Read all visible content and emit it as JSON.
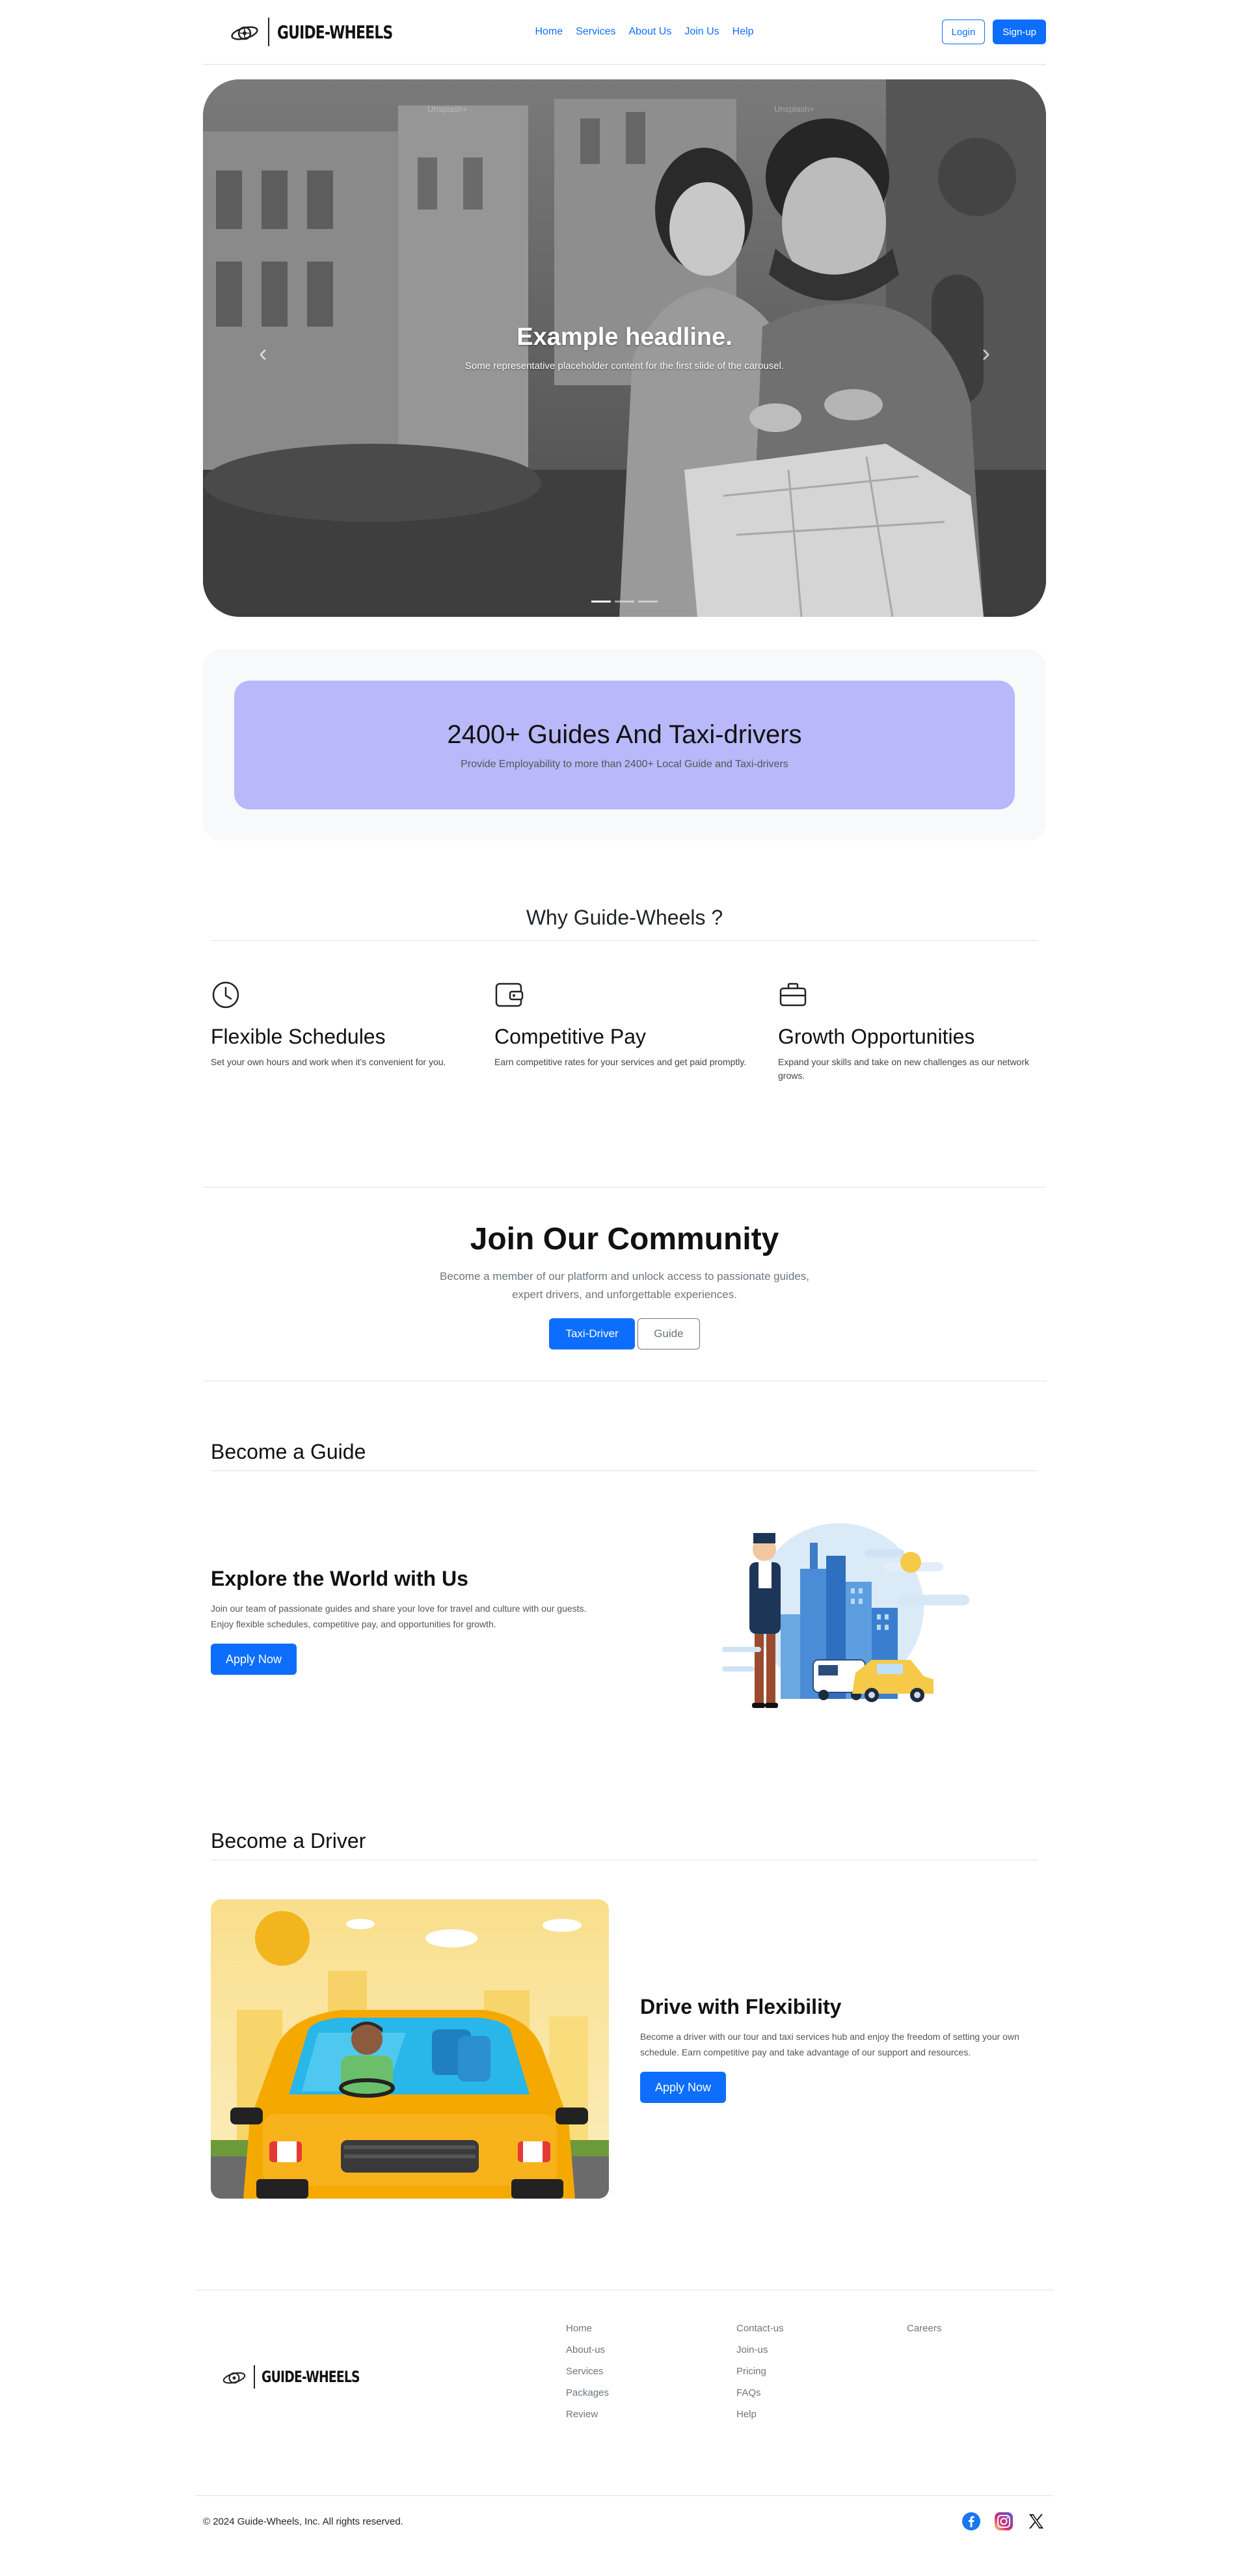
{
  "brand": {
    "name": "GUIDE-WHEELS"
  },
  "nav": {
    "items": [
      "Home",
      "Services",
      "About Us",
      "Join Us",
      "Help"
    ]
  },
  "auth": {
    "login": "Login",
    "signup": "Sign-up"
  },
  "hero": {
    "headline": "Example headline.",
    "caption": "Some representative placeholder content for the first slide of the carousel.",
    "watermarks": [
      "Unsplash+",
      "Unsplash+"
    ],
    "slides": 3,
    "active_slide": 1
  },
  "stats": {
    "title": "2400+ Guides And Taxi-drivers",
    "subtitle": "Provide Employability to more than 2400+ Local Guide and Taxi-drivers"
  },
  "why": {
    "title": "Why Guide-Wheels ?",
    "features": [
      {
        "icon": "clock-icon",
        "title": "Flexible Schedules",
        "text": "Set your own hours and work when it's convenient for you."
      },
      {
        "icon": "wallet-icon",
        "title": "Competitive Pay",
        "text": "Earn competitive rates for your services and get paid promptly."
      },
      {
        "icon": "briefcase-icon",
        "title": "Growth Opportunities",
        "text": "Expand your skills and take on new challenges as our network grows."
      }
    ]
  },
  "community": {
    "title": "Join Our Community",
    "text": "Become a member of our platform and unlock access to passionate guides, expert drivers, and unforgettable experiences.",
    "taxi_button": "Taxi-Driver",
    "guide_button": "Guide"
  },
  "guide_section": {
    "section_title": "Become a Guide",
    "heading": "Explore the World with Us",
    "text": "Join our team of passionate guides and share your love for travel and culture with our guests. Enjoy flexible schedules, competitive pay, and opportunities for growth.",
    "button": "Apply Now"
  },
  "driver_section": {
    "section_title": "Become a Driver",
    "heading": "Drive with Flexibility",
    "text": "Become a driver with our tour and taxi services hub and enjoy the freedom of setting your own schedule. Earn competitive pay and take advantage of our support and resources.",
    "button": "Apply Now"
  },
  "footer": {
    "col1": [
      "Home",
      "About-us",
      "Services",
      "Packages",
      "Review"
    ],
    "col2": [
      "Contact-us",
      "Join-us",
      "Pricing",
      "FAQs",
      "Help"
    ],
    "col3": [
      "Careers"
    ],
    "copyright": "© 2024 Guide-Wheels, Inc. All rights reserved.",
    "social": [
      "facebook-icon",
      "instagram-icon",
      "x-icon"
    ]
  },
  "colors": {
    "primary": "#0d6efd",
    "stats_card": "#b8b8fa",
    "taxi_yellow": "#f5b31c"
  }
}
